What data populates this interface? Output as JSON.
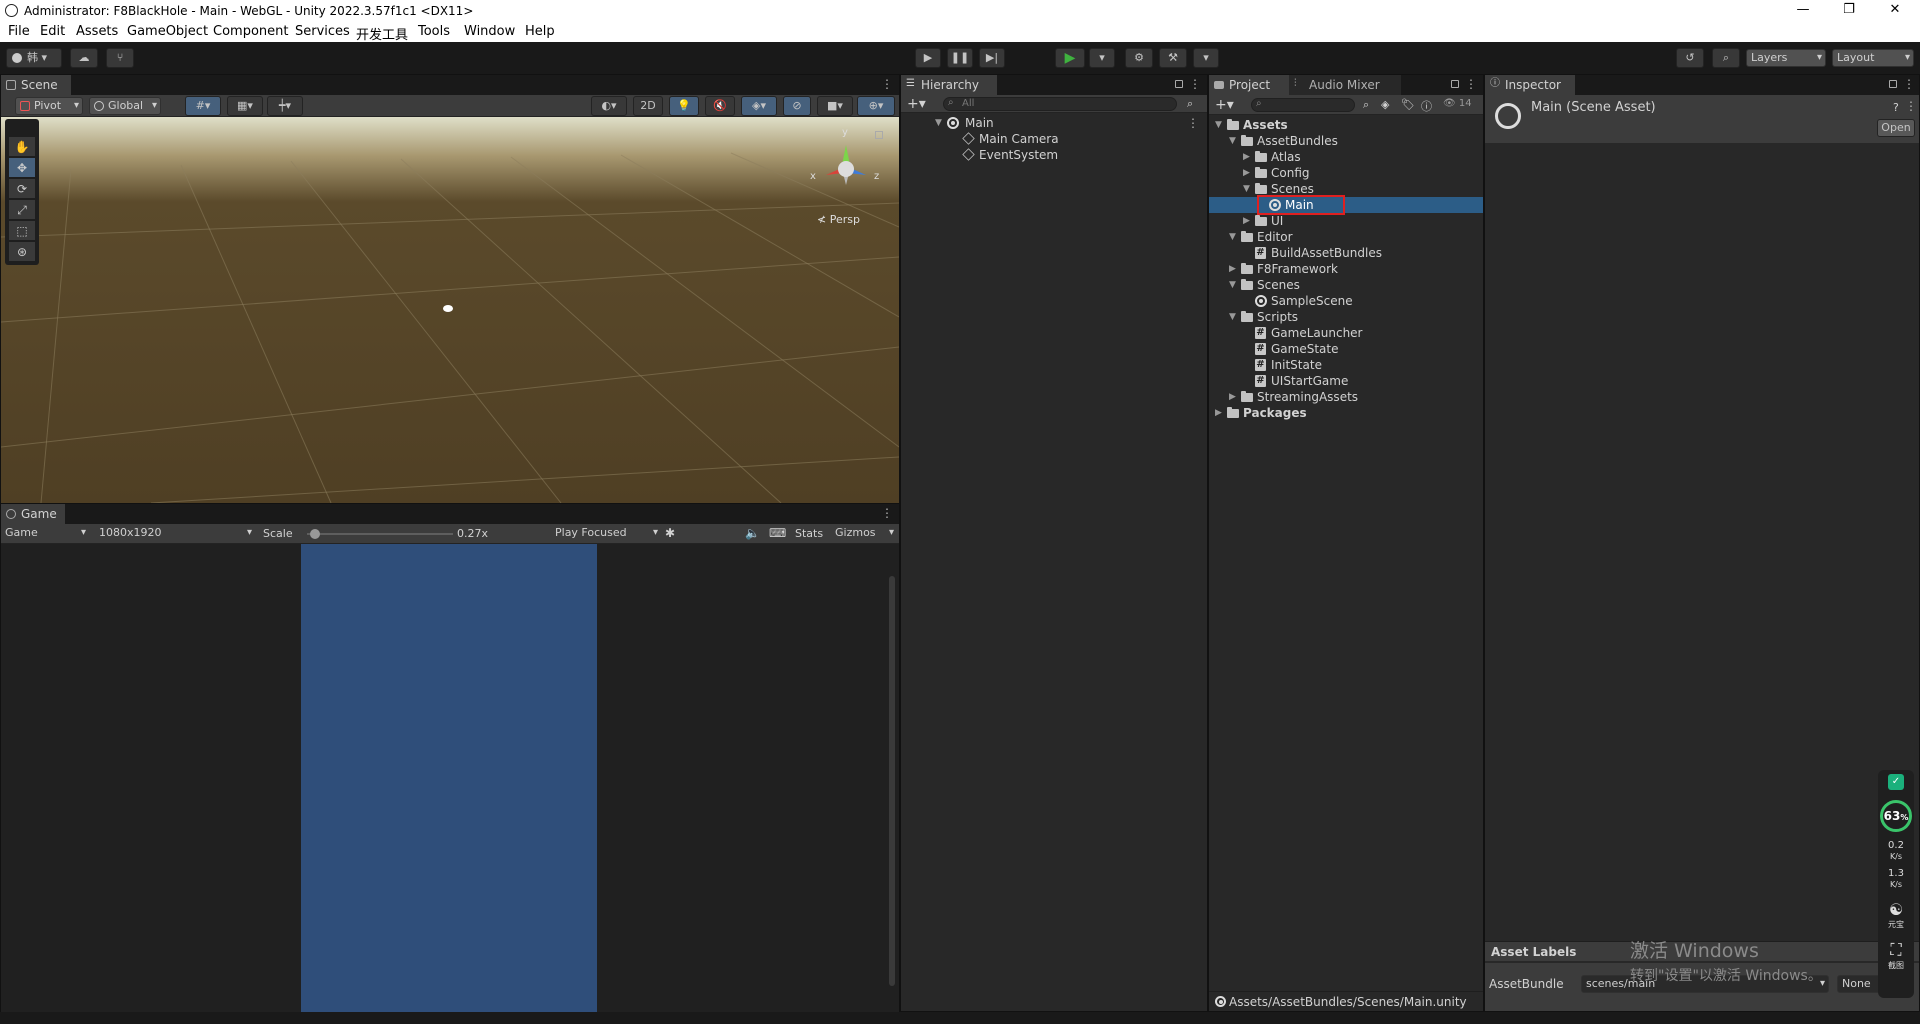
{
  "window": {
    "title": "Administrator: F8BlackHole - Main - WebGL - Unity 2022.3.57f1c1 <DX11>",
    "controls": {
      "minimize": "—",
      "maximize": "❐",
      "close": "✕"
    }
  },
  "menu": [
    "File",
    "Edit",
    "Assets",
    "GameObject",
    "Component",
    "Services",
    "开发工具",
    "Tools",
    "Window",
    "Help"
  ],
  "toolbar": {
    "account_label": "韩",
    "layers_label": "Layers",
    "layout_label": "Layout",
    "play_color": "#3fb23f"
  },
  "scene": {
    "tab_label": "Scene",
    "pivot_label": "Pivot",
    "global_label": "Global",
    "mode_2d": "2D",
    "persp_label": "Persp",
    "gizmo_y": "y",
    "gizmo_x": "x",
    "gizmo_z": "z"
  },
  "game": {
    "tab_label": "Game",
    "display_label": "Game",
    "resolution": "1080x1920",
    "scale_label": "Scale",
    "scale_value": "0.27x",
    "scale_fraction": 0.02,
    "play_mode": "Play Focused",
    "stats_label": "Stats",
    "gizmos_label": "Gizmos",
    "viewport_color": "#2f4e7a"
  },
  "hierarchy": {
    "tab_label": "Hierarchy",
    "search_placeholder": "All",
    "items": [
      {
        "label": "Main"
      },
      {
        "label": "Main Camera"
      },
      {
        "label": "EventSystem"
      }
    ]
  },
  "project": {
    "tab_label": "Project",
    "tab2_label": "Audio Mixer",
    "hidden_count": "14",
    "tree": [
      {
        "label": "Assets"
      },
      {
        "label": "AssetBundles"
      },
      {
        "label": "Atlas"
      },
      {
        "label": "Config"
      },
      {
        "label": "Scenes"
      },
      {
        "label": "Main"
      },
      {
        "label": "UI"
      },
      {
        "label": "Editor"
      },
      {
        "label": "BuildAssetBundles"
      },
      {
        "label": "F8Framework"
      },
      {
        "label": "Scenes"
      },
      {
        "label": "SampleScene"
      },
      {
        "label": "Scripts"
      },
      {
        "label": "GameLauncher"
      },
      {
        "label": "GameState"
      },
      {
        "label": "InitState"
      },
      {
        "label": "UIStartGame"
      },
      {
        "label": "StreamingAssets"
      },
      {
        "label": "Packages"
      }
    ],
    "footer_path": "Assets/AssetBundles/Scenes/Main.unity"
  },
  "inspector": {
    "tab_label": "Inspector",
    "asset_title": "Main (Scene Asset)",
    "open_button": "Open",
    "asset_labels": "Asset Labels",
    "assetbundle_label": "AssetBundle",
    "assetbundle_value": "scenes/main",
    "variant_value": "None"
  },
  "watermark": {
    "line1": "激活 Windows",
    "line2": "转到\"设置\"以激活 Windows。"
  },
  "floating_widget": {
    "percent": "63",
    "percent_unit": "%",
    "up_speed": "0.2",
    "up_unit": "K/s",
    "down_speed": "1.3",
    "down_unit": "K/s",
    "label1": "元宝",
    "label2": "截图"
  }
}
